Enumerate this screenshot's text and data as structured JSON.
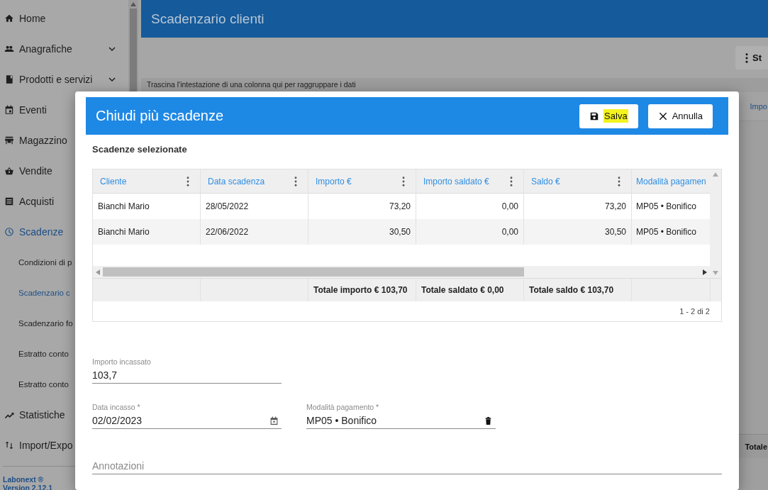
{
  "sidebar": {
    "items": [
      {
        "label": "Home",
        "selected": false
      },
      {
        "label": "Anagrafiche",
        "selected": false,
        "expanded": false
      },
      {
        "label": "Prodotti e servizi",
        "selected": false,
        "expanded": false
      },
      {
        "label": "Eventi",
        "selected": false
      },
      {
        "label": "Magazzino",
        "selected": false
      },
      {
        "label": "Vendite",
        "selected": false
      },
      {
        "label": "Acquisti",
        "selected": false
      },
      {
        "label": "Scadenze",
        "selected": true,
        "children": [
          {
            "label": "Condizioni di p",
            "selected": false
          },
          {
            "label": "Scadenzario c",
            "selected": true
          },
          {
            "label": "Scadenzario fo",
            "selected": false
          },
          {
            "label": "Estratto conto",
            "selected": false
          },
          {
            "label": "Estratto conto",
            "selected": false
          }
        ]
      },
      {
        "label": "Statistiche",
        "selected": false
      },
      {
        "label": "Import/Expo",
        "selected": false
      }
    ],
    "footer": [
      "Labonext ®",
      "Version 2.12.1"
    ]
  },
  "page": {
    "title": "Scadenzario clienti",
    "toolbar_button": "St",
    "hint": "Trascina l'intestazione di una colonna qui per raggruppare i dati",
    "grid_header": "Impo",
    "grid_footer": "Totale"
  },
  "dialog": {
    "title": "Chiudi più scadenze",
    "buttons": [
      {
        "label": "Salva",
        "kind": "save",
        "highlighted": true
      },
      {
        "label": "Annulla",
        "kind": "cancel",
        "highlighted": false
      }
    ],
    "section_title": "Scadenze selezionate",
    "table": {
      "columns": [
        {
          "label": "Cliente",
          "kind": "text"
        },
        {
          "label": "Data scadenza",
          "kind": "text"
        },
        {
          "label": "Importo €",
          "kind": "number"
        },
        {
          "label": "Importo saldato €",
          "kind": "number"
        },
        {
          "label": "Saldo €",
          "kind": "number"
        },
        {
          "label": "Modalità pagamen",
          "kind": "text"
        }
      ],
      "rows": [
        {
          "cells": [
            "Bianchi Mario",
            "28/05/2022",
            "73,20",
            "0,00",
            "73,20",
            "MP05 • Bonifico"
          ]
        },
        {
          "cells": [
            "Bianchi Mario",
            "22/06/2022",
            "30,50",
            "0,00",
            "30,50",
            "MP05 • Bonifico"
          ]
        }
      ],
      "footer": {
        "column_3": "Totale importo € 103,70",
        "column_4": "Totale saldato € 0,00",
        "column_5": "Totale saldo € 103,70"
      },
      "pager": "1 - 2 di 2"
    },
    "fields": [
      {
        "label": "Importo incassato",
        "value": "103,7",
        "kind": "text"
      },
      {
        "label": "Data incasso *",
        "value": "02/02/2023",
        "kind": "date"
      },
      {
        "label": "Modalità pagamento *",
        "value": "MP05 • Bonifico",
        "kind": "select"
      }
    ],
    "notes": {
      "placeholder": "Annotazioni"
    }
  }
}
